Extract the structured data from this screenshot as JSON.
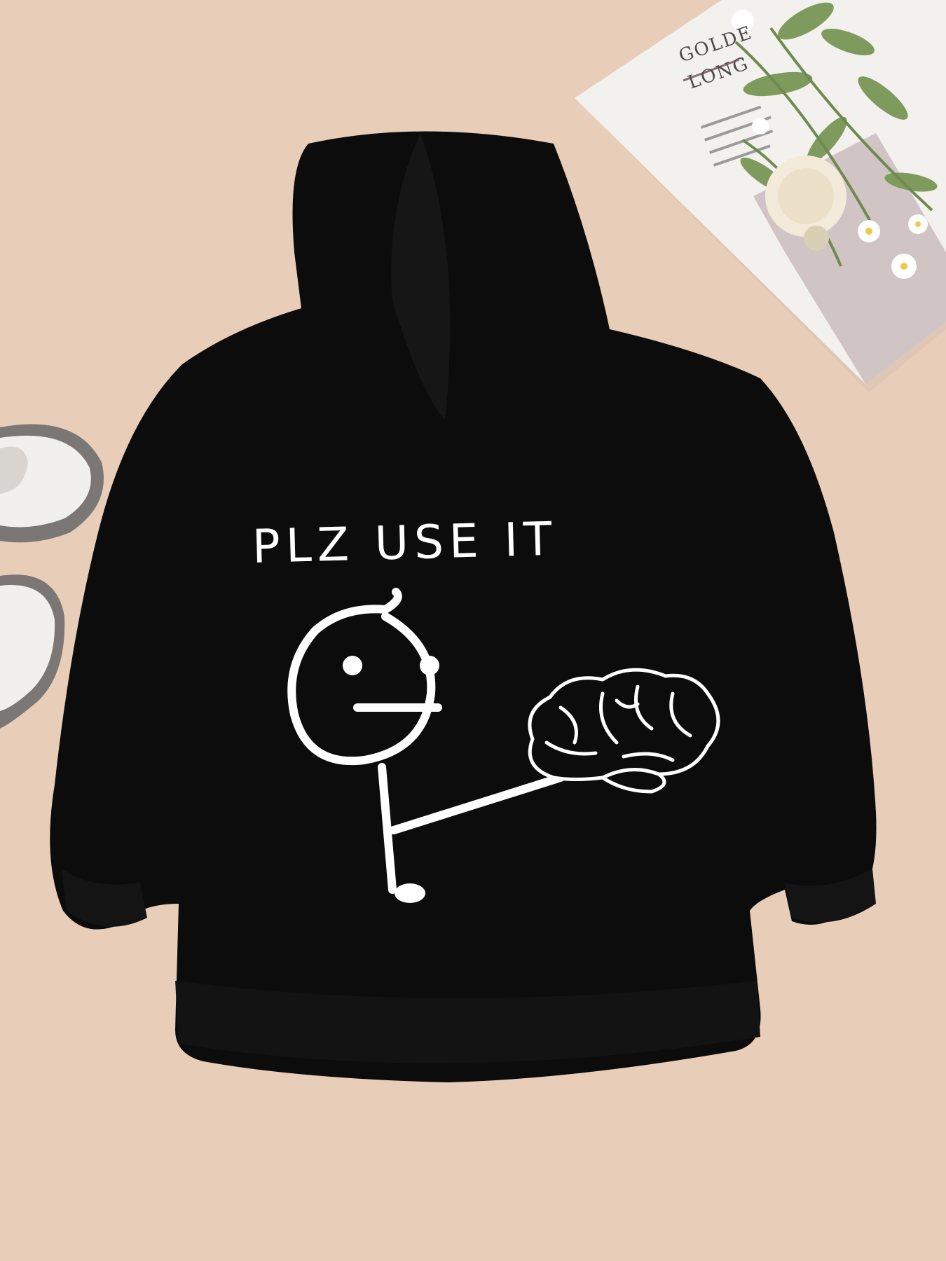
{
  "print": {
    "text": "PLZ USE IT"
  },
  "magazine": {
    "title": "GOLDE\nLONG"
  },
  "colors": {
    "background": "#e8cdb8",
    "hoodie": "#0c0c0c",
    "print": "#ffffff",
    "paper": "#f3f1ee",
    "shoe": "#f2f0ec",
    "shoe_sole": "#7b7775"
  }
}
